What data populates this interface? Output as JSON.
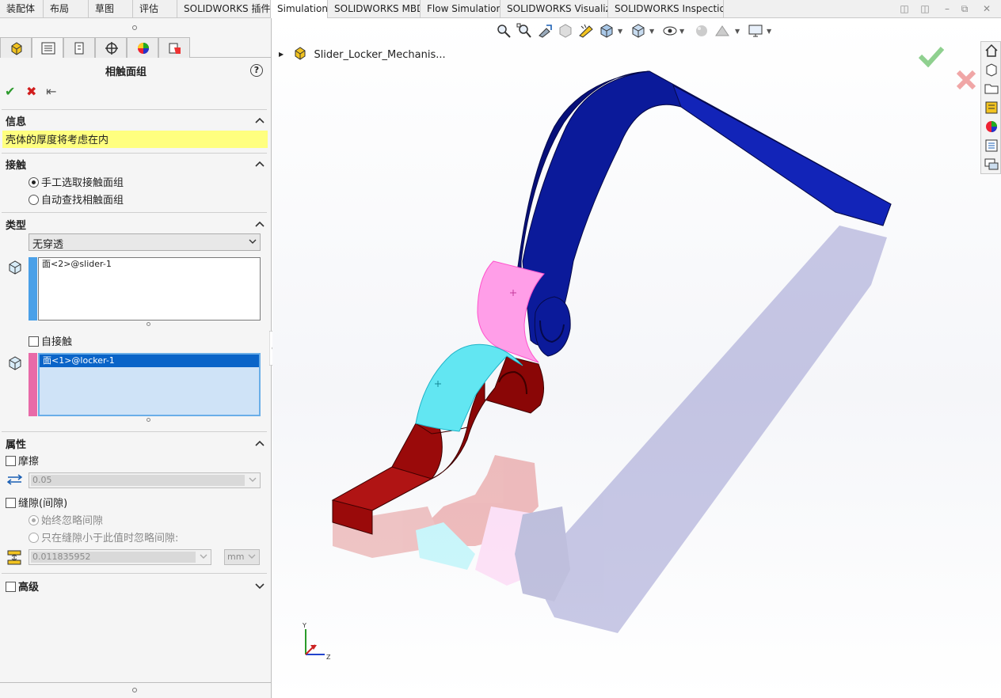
{
  "tabs": [
    "装配体",
    "布局",
    "草图",
    "评估",
    "SOLIDWORKS 插件",
    "Simulation",
    "SOLIDWORKS MBD",
    "Flow Simulation",
    "SOLIDWORKS Visualize",
    "SOLIDWORKS Inspection"
  ],
  "active_tab": "Simulation",
  "panel": {
    "title": "相触面组",
    "help": "?",
    "info": {
      "heading": "信息",
      "message": "壳体的厚度将考虑在内"
    },
    "contact": {
      "heading": "接触",
      "options": [
        "手工选取接触面组",
        "自动查找相触面组"
      ],
      "selected": 0
    },
    "type": {
      "heading": "类型",
      "value": "无穿透",
      "set1": [
        "面<2>@slider-1"
      ],
      "self_contact": "自接触",
      "set2": [
        "面<1>@locker-1"
      ]
    },
    "properties": {
      "heading": "属性",
      "friction_label": "摩擦",
      "friction_value": "0.05",
      "gap_label": "缝隙(间隙)",
      "gap_options": [
        "始终忽略间隙",
        "只在缝隙小于此值时忽略间隙:"
      ],
      "gap_value": "0.011835952",
      "gap_unit": "mm"
    },
    "advanced": "高级"
  },
  "viewport": {
    "tree_root": "Slider_Locker_Mechanis...",
    "triad": [
      "Y",
      "Z"
    ]
  },
  "colors": {
    "info_bg": "#ffff7f",
    "blue_part": "#0b1a9a",
    "red_part": "#9a0a0a",
    "pink_face": "#ff9ee8",
    "cyan_face": "#62e6f2",
    "accept_green": "#2e9b2e",
    "cancel_red": "#d11d1d"
  }
}
